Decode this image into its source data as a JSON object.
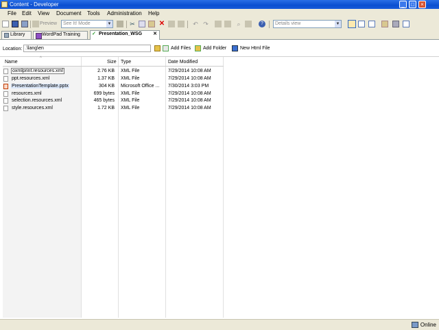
{
  "window": {
    "title": "Content - Developer"
  },
  "menu": [
    "File",
    "Edit",
    "View",
    "Document",
    "Tools",
    "Administration",
    "Help"
  ],
  "toolbar": {
    "preview_label": "Preview",
    "mode_value": "See It! Mode",
    "view_value": "Details view"
  },
  "tabs": [
    {
      "label": "Library"
    },
    {
      "label": "WordPad Training"
    },
    {
      "label": "Presentation_WSG",
      "active": true
    }
  ],
  "location": {
    "label": "Location:",
    "value": ".\\lang\\en",
    "add_files": "Add Files",
    "add_folder": "Add Folder",
    "new_html_file": "New Html File"
  },
  "table": {
    "headers": {
      "name": "Name",
      "size": "Size",
      "type": "Type",
      "date": "Date Modified"
    },
    "rows": [
      {
        "name": "oxmlprint.resources.xml",
        "size": "2.76 KB",
        "type": "XML File",
        "date": "7/29/2014 10:08 AM",
        "icon": "xml-file-icon"
      },
      {
        "name": "ppt.resources.xml",
        "size": "1.37 KB",
        "type": "XML File",
        "date": "7/29/2014 10:08 AM",
        "icon": "xml-file-icon"
      },
      {
        "name": "PresentationTemplate.pptx",
        "size": "304 KB",
        "type": "Microsoft Office ...",
        "date": "7/30/2014 3:03 PM",
        "icon": "pptx-file-icon"
      },
      {
        "name": "resources.xml",
        "size": "699 bytes",
        "type": "XML File",
        "date": "7/29/2014 10:08 AM",
        "icon": "xml-file-icon"
      },
      {
        "name": "selection.resources.xml",
        "size": "465 bytes",
        "type": "XML File",
        "date": "7/29/2014 10:08 AM",
        "icon": "xml-file-icon"
      },
      {
        "name": "style.resources.xml",
        "size": "1.72 KB",
        "type": "XML File",
        "date": "7/29/2014 10:08 AM",
        "icon": "xml-file-icon"
      }
    ]
  },
  "status": {
    "text": "Online"
  },
  "colors": {
    "titlebar": "#0a4fd0",
    "selection": "#dde9fb",
    "accent": "#316ac5"
  }
}
